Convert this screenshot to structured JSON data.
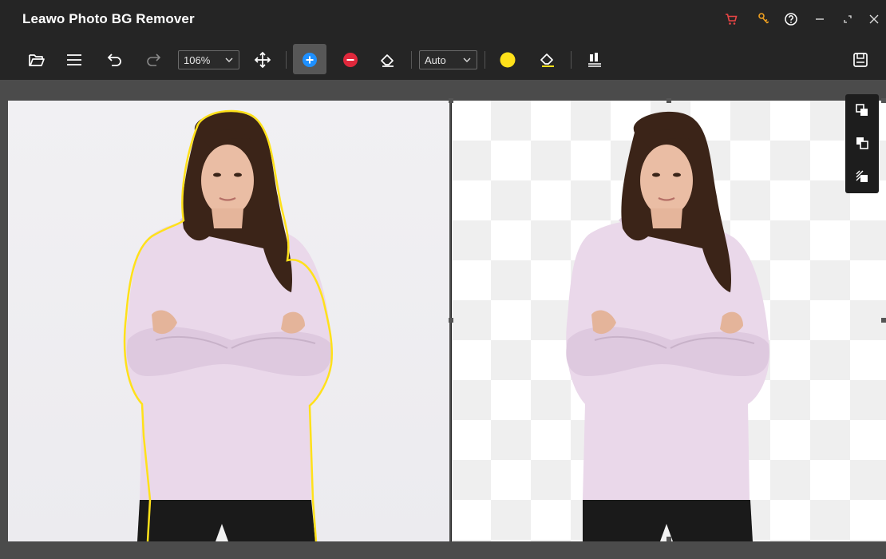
{
  "app": {
    "title": "Leawo Photo BG Remover"
  },
  "titlebar": {
    "icons": [
      "cart-icon",
      "key-icon",
      "help-icon",
      "minimize-icon",
      "restore-icon",
      "close-icon"
    ],
    "accent_cart": "#e84545",
    "accent_key": "#f0a020"
  },
  "toolbar": {
    "zoom": {
      "value": "106%"
    },
    "mode": {
      "value": "Auto"
    },
    "brush_color": "#ffe11a",
    "add_color": "#1e90ff",
    "remove_color": "#e0283c"
  },
  "side_panel": {
    "icons": [
      "copy-front-icon",
      "copy-back-icon",
      "transparent-layer-icon"
    ]
  }
}
